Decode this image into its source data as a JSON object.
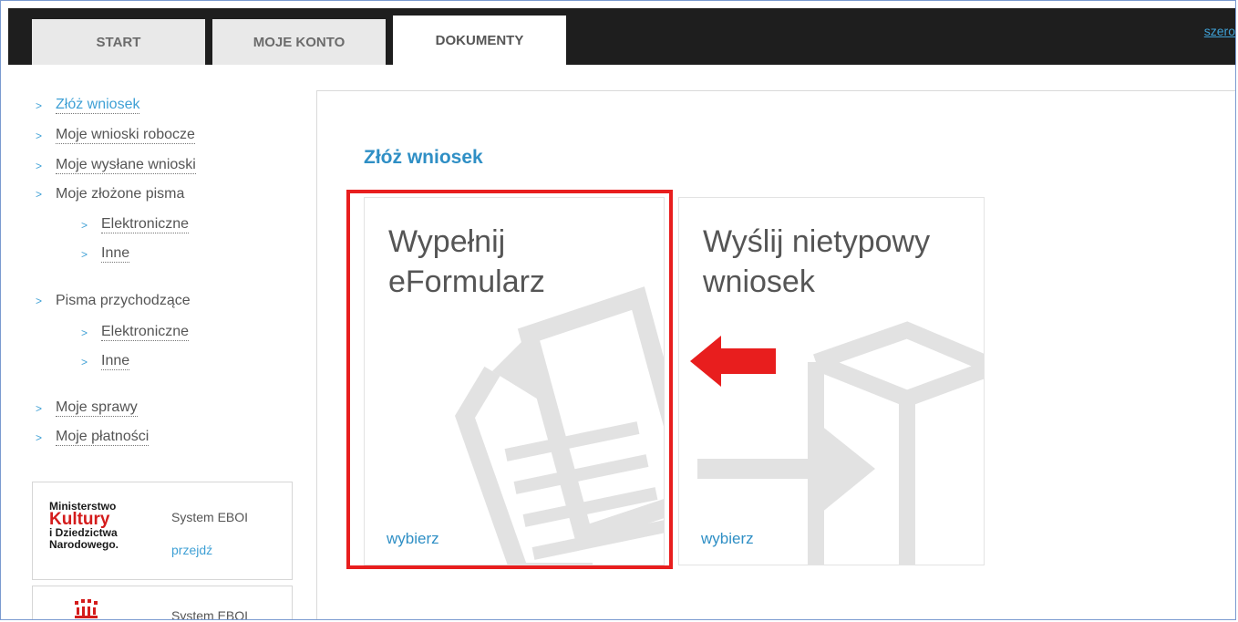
{
  "tabs": [
    {
      "label": "START"
    },
    {
      "label": "MOJE KONTO"
    },
    {
      "label": "DOKUMENTY",
      "active": true
    }
  ],
  "top_link": "szero",
  "nav": {
    "items": [
      {
        "label": "Złóż wniosek"
      },
      {
        "label": "Moje wnioski robocze"
      },
      {
        "label": "Moje wysłane wnioski"
      },
      {
        "label": "Moje złożone pisma"
      },
      {
        "label": "Elektroniczne"
      },
      {
        "label": "Inne"
      },
      {
        "label": "Pisma przychodzące"
      },
      {
        "label": "Elektroniczne"
      },
      {
        "label": "Inne"
      },
      {
        "label": "Moje sprawy"
      },
      {
        "label": "Moje płatności"
      }
    ]
  },
  "promos": [
    {
      "logo_lines": [
        "Ministerstwo",
        "Kultury",
        "i Dziedzictwa",
        "Narodowego."
      ],
      "system": "System EBOI",
      "link": "przejdź"
    },
    {
      "system": "System EBOI"
    }
  ],
  "panel": {
    "title": "Złóż wniosek",
    "tiles": [
      {
        "title": "Wypełnij\neFormularz",
        "link": "wybierz"
      },
      {
        "title": "Wyślij nietypowy\nwniosek",
        "link": "wybierz"
      }
    ]
  },
  "colors": {
    "accent": "#2f8fc5",
    "highlight": "#e81e1e",
    "topbar": "#1e1e1e"
  },
  "icons": [
    "document-icon",
    "send-box-icon",
    "arrow-left-icon",
    "chevron-right-icon"
  ]
}
